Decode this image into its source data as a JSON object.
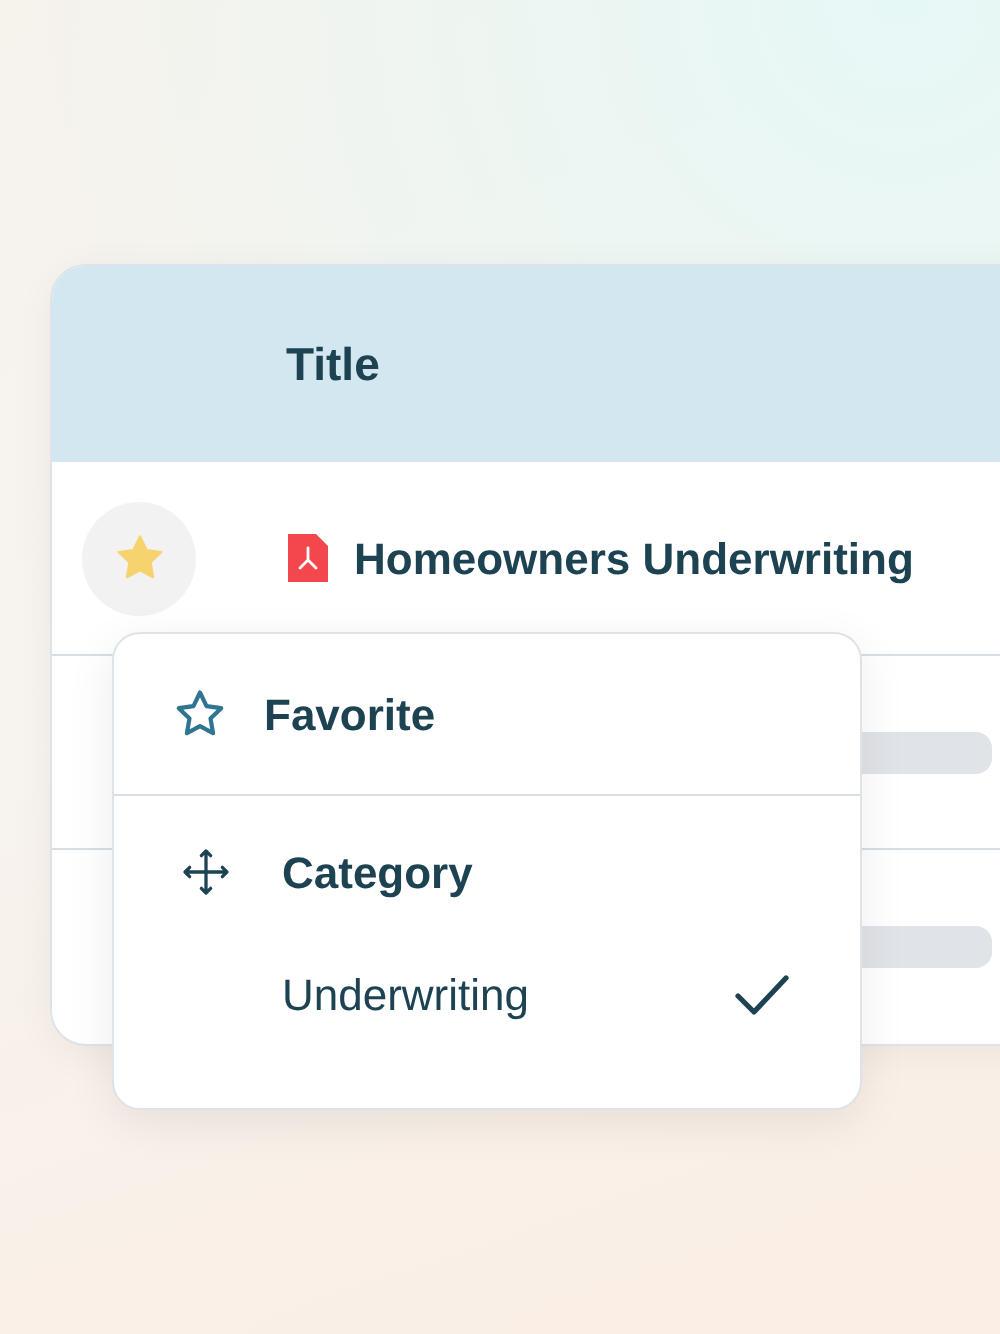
{
  "table": {
    "columns": [
      "Title"
    ],
    "rows": [
      {
        "kind": "document",
        "favorite": true,
        "title": "Homeowners Underwriting"
      },
      {
        "kind": "loading"
      },
      {
        "kind": "loading"
      }
    ]
  },
  "menu": {
    "items": [
      {
        "kind": "action",
        "label": "Favorite"
      },
      {
        "kind": "heading",
        "label": "Category"
      },
      {
        "kind": "option",
        "label": "Underwriting",
        "selected": true
      }
    ]
  }
}
